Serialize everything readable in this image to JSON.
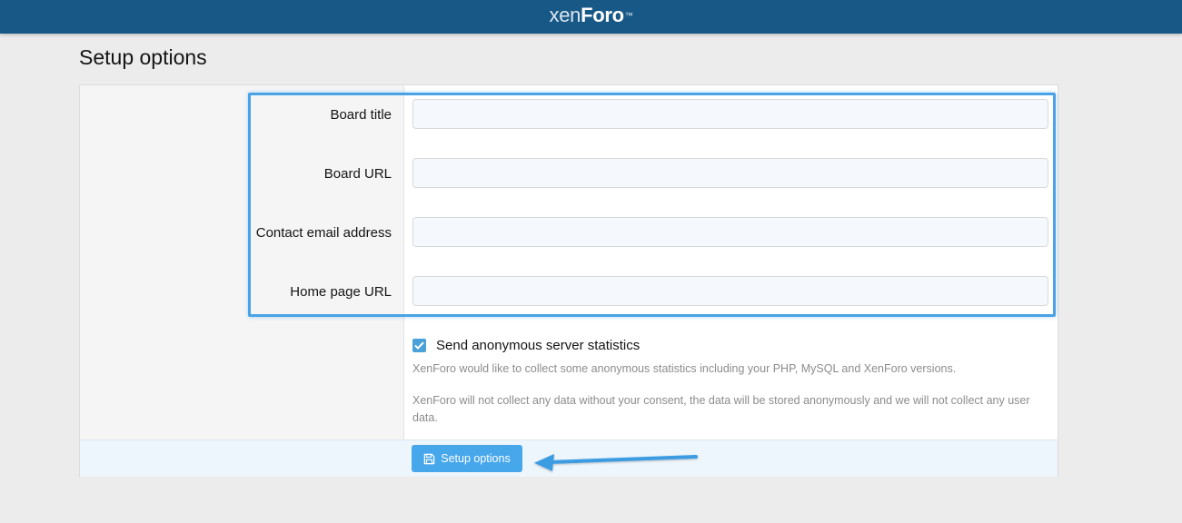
{
  "header": {
    "logo_part1": "xen",
    "logo_part2": "Foro",
    "logo_tm": "™"
  },
  "page": {
    "title": "Setup options"
  },
  "form": {
    "fields": [
      {
        "label": "Board title",
        "value": "",
        "placeholder": ""
      },
      {
        "label": "Board URL",
        "value": "",
        "placeholder": ""
      },
      {
        "label": "Contact email address",
        "value": "",
        "placeholder": ""
      },
      {
        "label": "Home page URL",
        "value": "",
        "placeholder": ""
      }
    ],
    "stats_checkbox": {
      "label": "Send anonymous server statistics",
      "checked": true,
      "hint1": "XenForo would like to collect some anonymous statistics including your PHP, MySQL and XenForo versions.",
      "hint2": "XenForo will not collect any data without your consent, the data will be stored anonymously and we will not collect any user data."
    },
    "submit_label": "Setup options"
  },
  "icons": {
    "submit": "save-icon",
    "checkbox": "checkmark-icon"
  },
  "colors": {
    "header_bg": "#185886",
    "accent": "#47a7eb",
    "highlight": "#4aa3e6",
    "page_bg": "#ececec"
  }
}
